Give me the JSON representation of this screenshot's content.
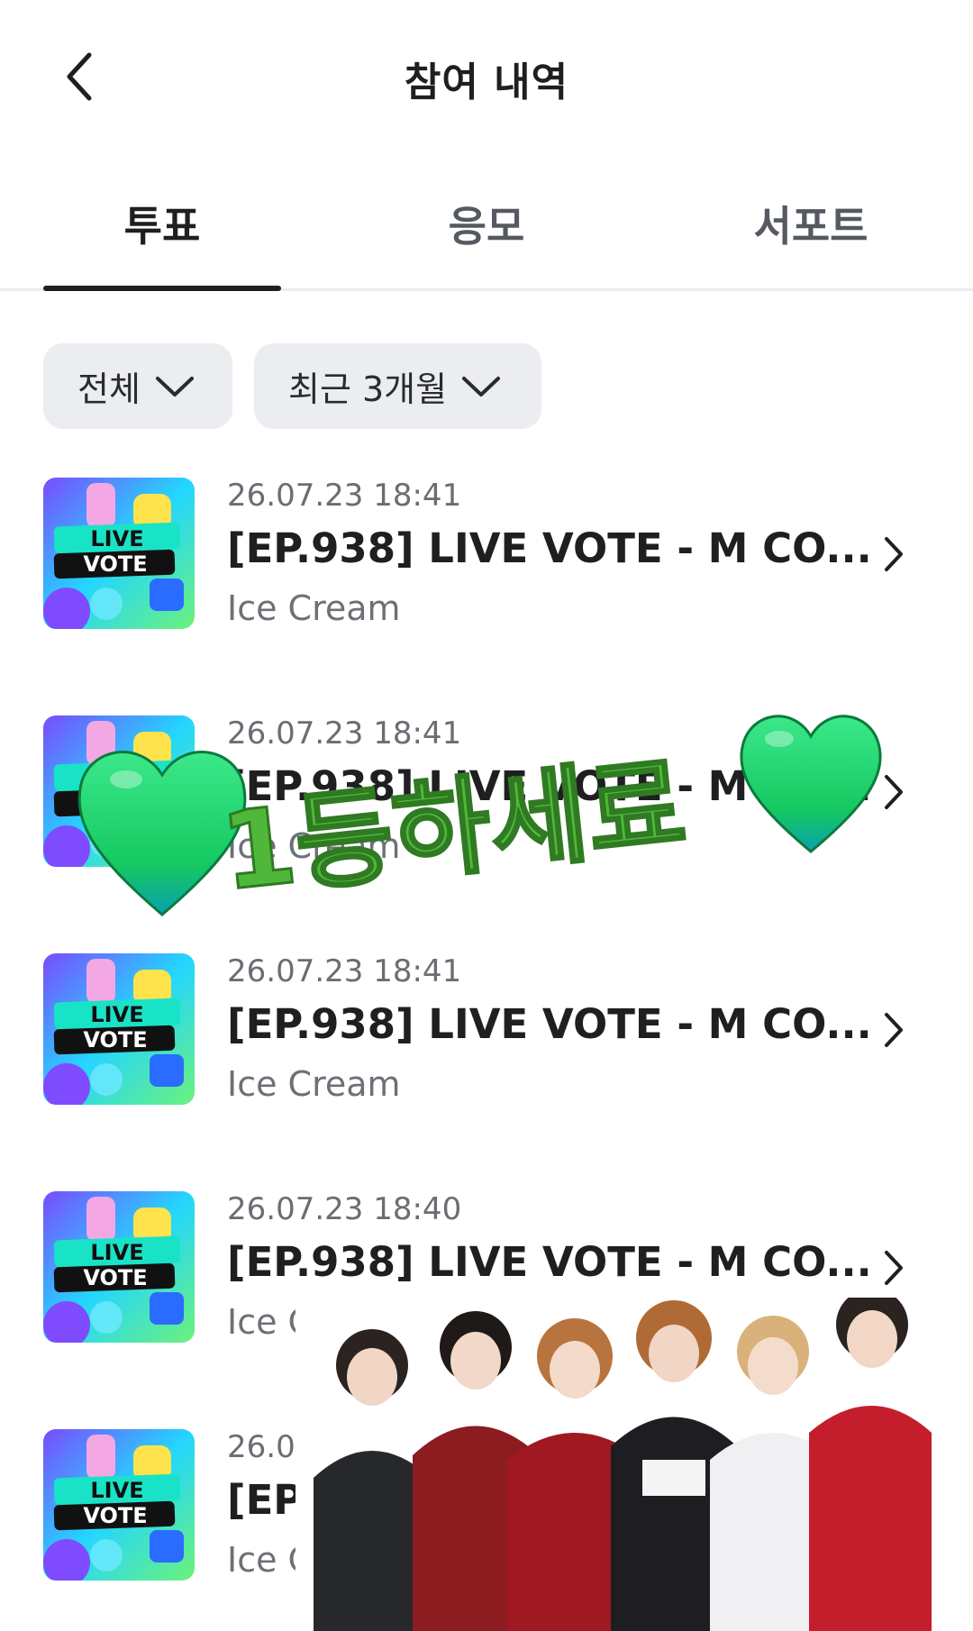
{
  "header": {
    "title": "참여 내역"
  },
  "tabs": [
    {
      "label": "투표",
      "active": true
    },
    {
      "label": "응모",
      "active": false
    },
    {
      "label": "서포트",
      "active": false
    }
  ],
  "filters": {
    "type": "전체",
    "period": "최근 3개월"
  },
  "thumbnail": {
    "line1": "LIVE",
    "line2": "VOTE"
  },
  "items": [
    {
      "datetime": "26.07.23 18:41",
      "title": "[EP.938] LIVE VOTE - M CO...",
      "subtitle": "Ice Cream"
    },
    {
      "datetime": "26.07.23 18:41",
      "title": "[EP.938] LIVE VOTE - M CO...",
      "subtitle": "Ice Cream"
    },
    {
      "datetime": "26.07.23 18:41",
      "title": "[EP.938] LIVE VOTE - M CO...",
      "subtitle": "Ice Cream"
    },
    {
      "datetime": "26.07.23 18:40",
      "title": "[EP.938] LIVE VOTE - M CO...",
      "subtitle": "Ice Cream"
    },
    {
      "datetime": "26.07",
      "title": "[EP",
      "subtitle": "Ice C"
    }
  ],
  "sticker": {
    "text": "1등하세료"
  },
  "colors": {
    "active_text": "#1f1f22",
    "inactive_text": "#555a61",
    "filter_bg": "#ebedf0",
    "sticker_green": "#4fb83a",
    "heart_green": "#22d46e"
  }
}
